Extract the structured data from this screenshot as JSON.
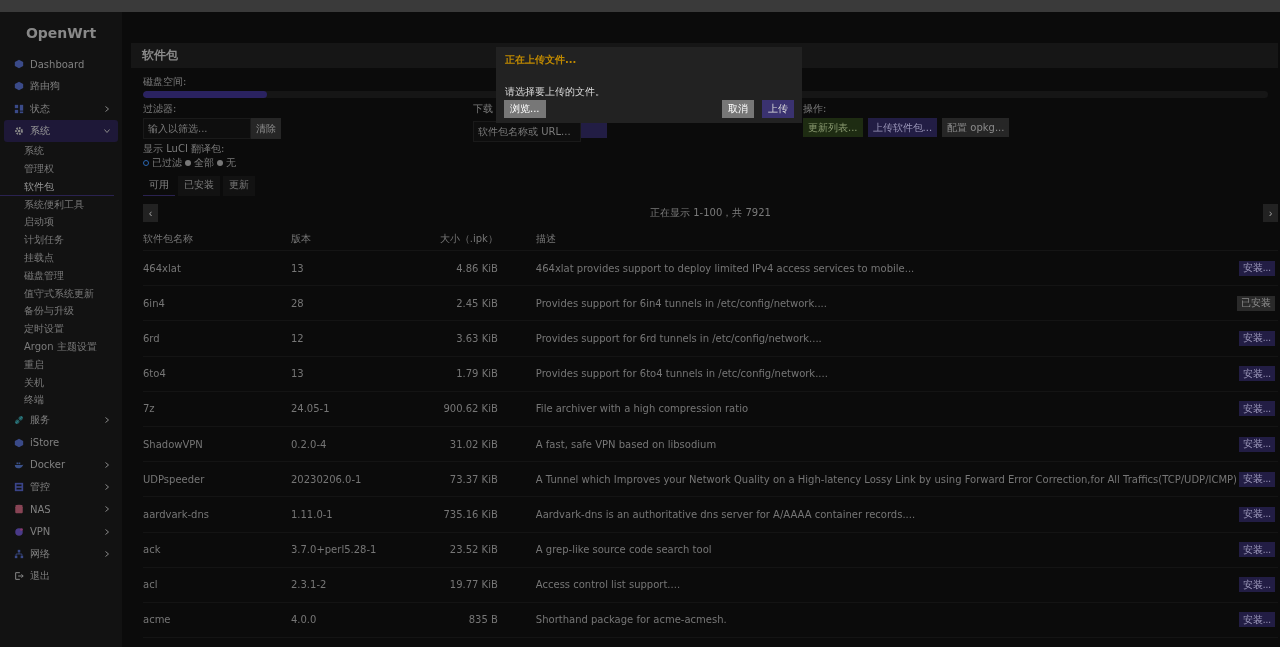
{
  "sidebar": {
    "logo": "OpenWrt",
    "items": [
      {
        "label": "Dashboard",
        "selected": false
      },
      {
        "label": "路由狗",
        "selected": false
      },
      {
        "label": "状态",
        "expanded": false,
        "selected": false
      },
      {
        "label": "系统",
        "expanded": true,
        "selected": true,
        "children": [
          {
            "label": "系统",
            "selected": false
          },
          {
            "label": "管理权",
            "selected": false
          },
          {
            "label": "软件包",
            "selected": true
          },
          {
            "label": "系统便利工具",
            "selected": false
          },
          {
            "label": "启动项",
            "selected": false
          },
          {
            "label": "计划任务",
            "selected": false
          },
          {
            "label": "挂载点",
            "selected": false
          },
          {
            "label": "磁盘管理",
            "selected": false
          },
          {
            "label": "值守式系统更新",
            "selected": false
          },
          {
            "label": "备份与升级",
            "selected": false
          },
          {
            "label": "定时设置",
            "selected": false
          },
          {
            "label": "Argon 主题设置",
            "selected": false
          },
          {
            "label": "重启",
            "selected": false
          },
          {
            "label": "关机",
            "selected": false
          },
          {
            "label": "终端",
            "selected": false
          }
        ]
      },
      {
        "label": "服务",
        "expanded": false,
        "selected": false
      },
      {
        "label": "iStore",
        "selected": false
      },
      {
        "label": "Docker",
        "expanded": false,
        "selected": false
      },
      {
        "label": "管控",
        "expanded": false,
        "selected": false
      },
      {
        "label": "NAS",
        "expanded": false,
        "selected": false
      },
      {
        "label": "VPN",
        "expanded": false,
        "selected": false
      },
      {
        "label": "网络",
        "expanded": false,
        "selected": false
      },
      {
        "label": "退出",
        "selected": false
      }
    ]
  },
  "page": {
    "title": "软件包",
    "disk": {
      "label": "磁盘空间:",
      "level": 0.11
    },
    "filter": {
      "label": "过滤器:",
      "placeholder": "输入以筛选...",
      "clear": "清除"
    },
    "download": {
      "label": "下载",
      "placeholder": "软件包名称或 URL..."
    },
    "actions": {
      "label": "操作:",
      "buttons": [
        {
          "label": "更新列表...",
          "kind": "positive"
        },
        {
          "label": "上传软件包...",
          "kind": "primary"
        },
        {
          "label": "配置 opkg...",
          "kind": "neutral"
        }
      ]
    },
    "luci": {
      "label": "显示 LuCI 翻译包:",
      "options": [
        {
          "label": "已过滤",
          "selected": true
        },
        {
          "label": "全部",
          "selected": false
        },
        {
          "label": "无",
          "selected": false
        }
      ]
    },
    "tabs": [
      {
        "label": "可用",
        "selected": true
      },
      {
        "label": "已安装",
        "selected": false
      },
      {
        "label": "更新",
        "selected": false
      }
    ],
    "pager": {
      "prev": "‹",
      "info": "正在显示 1-100，共 7921",
      "next": "›"
    },
    "table": {
      "columns": [
        "软件包名称",
        "版本",
        "大小（.ipk）",
        "描述"
      ],
      "rows": [
        {
          "name": "464xlat",
          "version": "13",
          "size": "4.86 KiB",
          "description": "464xlat provides support to deploy limited IPv4 access services to mobile...",
          "action": "安装...",
          "kind": "install"
        },
        {
          "name": "6in4",
          "version": "28",
          "size": "2.45 KiB",
          "description": "Provides support for 6in4 tunnels in /etc/config/network....",
          "action": "已安装",
          "kind": "installed"
        },
        {
          "name": "6rd",
          "version": "12",
          "size": "3.63 KiB",
          "description": "Provides support for 6rd tunnels in /etc/config/network....",
          "action": "安装...",
          "kind": "install"
        },
        {
          "name": "6to4",
          "version": "13",
          "size": "1.79 KiB",
          "description": "Provides support for 6to4 tunnels in /etc/config/network....",
          "action": "安装...",
          "kind": "install"
        },
        {
          "name": "7z",
          "version": "24.05-1",
          "size": "900.62 KiB",
          "description": "File archiver with a high compression ratio",
          "action": "安装...",
          "kind": "install"
        },
        {
          "name": "ShadowVPN",
          "version": "0.2.0-4",
          "size": "31.02 KiB",
          "description": "A fast, safe VPN based on libsodium",
          "action": "安装...",
          "kind": "install"
        },
        {
          "name": "UDPspeeder",
          "version": "20230206.0-1",
          "size": "73.37 KiB",
          "description": "A Tunnel which Improves your Network Quality on a High-latency Lossy Link by using Forward Error Correction,for All Traffics(TCP/UDP/ICMP)",
          "action": "安装...",
          "kind": "install"
        },
        {
          "name": "aardvark-dns",
          "version": "1.11.0-1",
          "size": "735.16 KiB",
          "description": "Aardvark-dns is an authoritative dns server for A/AAAA container records....",
          "action": "安装...",
          "kind": "install"
        },
        {
          "name": "ack",
          "version": "3.7.0+perl5.28-1",
          "size": "23.52 KiB",
          "description": "A grep-like source code search tool",
          "action": "安装...",
          "kind": "install"
        },
        {
          "name": "acl",
          "version": "2.3.1-2",
          "size": "19.77 KiB",
          "description": "Access control list support....",
          "action": "安装...",
          "kind": "install"
        },
        {
          "name": "acme",
          "version": "4.0.0",
          "size": "835 B",
          "description": "Shorthand package for acme-acmesh.",
          "action": "安装...",
          "kind": "install"
        }
      ]
    }
  },
  "modal": {
    "title": "正在上传文件...",
    "message": "请选择要上传的文件。",
    "browse": "浏览...",
    "cancel": "取消",
    "upload": "上传"
  }
}
